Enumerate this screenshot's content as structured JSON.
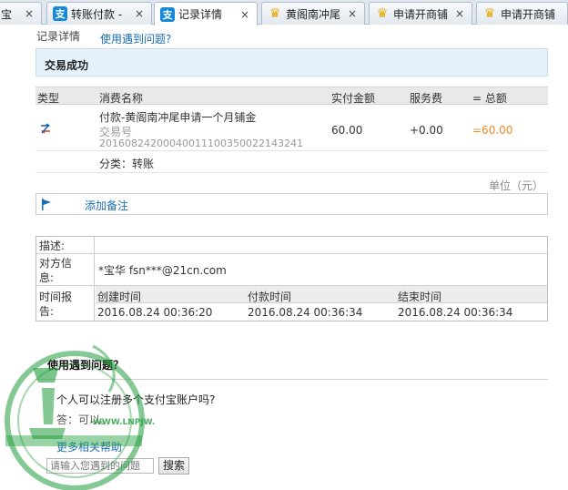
{
  "tabs": [
    {
      "label": "宝",
      "icon": "none",
      "active": false
    },
    {
      "label": "转账付款 -",
      "icon": "alipay-icon",
      "active": false
    },
    {
      "label": "记录详情",
      "icon": "alipay-icon",
      "active": true
    },
    {
      "label": "黄阁南冲尾",
      "icon": "bell-icon",
      "active": false
    },
    {
      "label": "申请开商铺",
      "icon": "bell-icon",
      "active": false
    },
    {
      "label": "申请开商铺",
      "icon": "bell-icon",
      "active": false
    }
  ],
  "tab_close_glyph": "×",
  "header": {
    "title": "记录详情",
    "help_link": "使用遇到问题?"
  },
  "status": {
    "text": "交易成功"
  },
  "table": {
    "headers": {
      "type": "类型",
      "name": "消费名称",
      "amount": "实付金额",
      "fee": "服务费",
      "total": "= 总额"
    },
    "row": {
      "name": "付款-黄阁南冲尾申请一个月铺金",
      "trade_no_label": "交易号",
      "trade_no": "2016082420004001110035002214324​1",
      "amount": "60.00",
      "fee": "+0.00",
      "total": "=60.00"
    },
    "category": "分类：转账"
  },
  "unit": "单位（元）",
  "remark_link": "添加备注",
  "info": {
    "desc_label": "描述:",
    "counterparty_label_1": "对方信",
    "counterparty_label_2": "息:",
    "counterparty_value": "*宝华 fsn***@21cn.com",
    "time_label_1": "时间报",
    "time_label_2": "告:",
    "created_label": "创建时间",
    "paid_label": "付款时间",
    "ended_label": "结束时间",
    "created_value": "2016.08.24 00:36:20",
    "paid_value": "2016.08.24 00:36:34",
    "ended_value": "2016.08.24 00:36:34"
  },
  "help": {
    "title": "使用遇到问题？",
    "question": "个人可以注册多个支付宝账户吗?",
    "answer": "答：可以。",
    "more_link": "更多相关帮助",
    "search_placeholder": "请输入您遇到的问题",
    "search_button": "搜索"
  },
  "watermark": {
    "domain": "WWW.LNPJW.COM"
  },
  "colors": {
    "link": "#1a6fb5",
    "total": "#f08a24",
    "status_bg": "#e6f2fb",
    "watermark": "#1f9d3a"
  }
}
